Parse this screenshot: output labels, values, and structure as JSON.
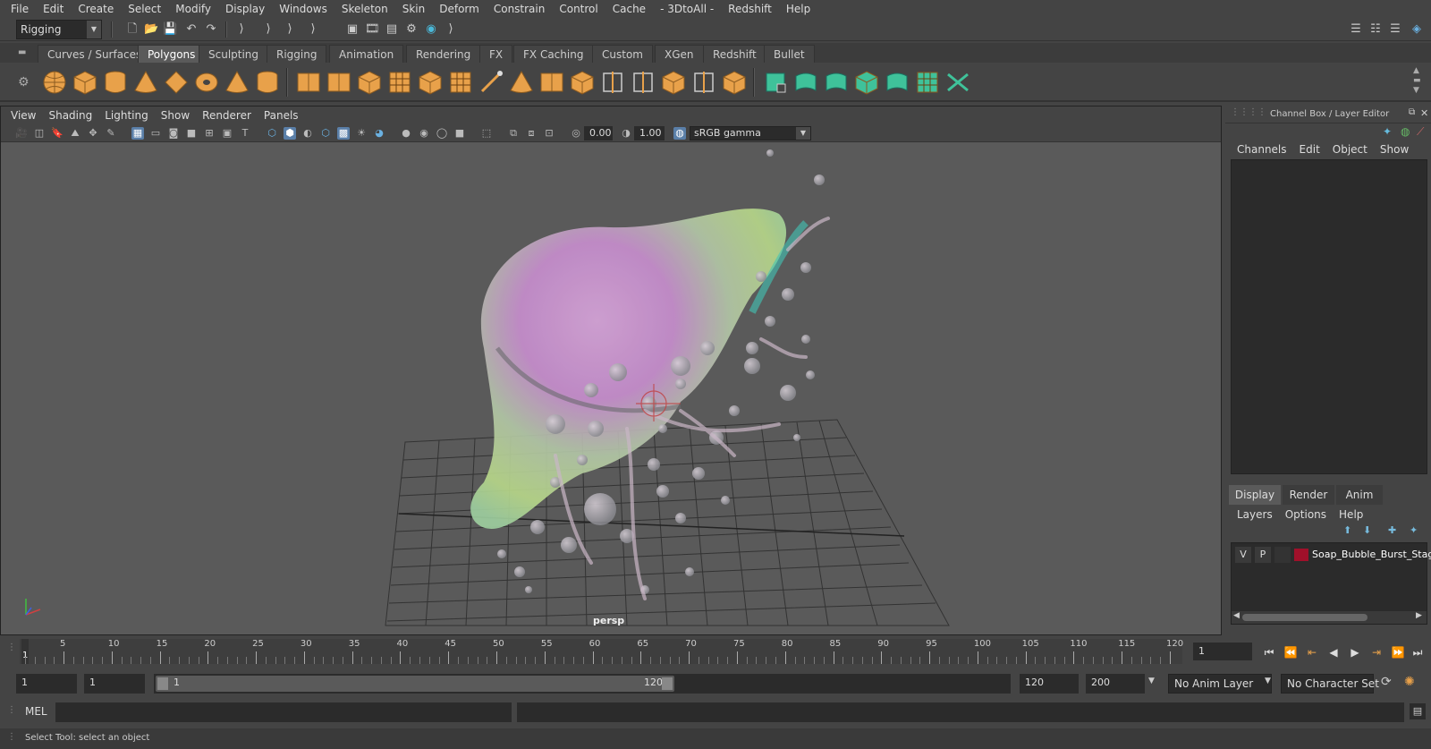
{
  "menu": [
    "File",
    "Edit",
    "Create",
    "Select",
    "Modify",
    "Display",
    "Windows",
    "Skeleton",
    "Skin",
    "Deform",
    "Constrain",
    "Control",
    "Cache",
    "- 3DtoAll -",
    "Redshift",
    "Help"
  ],
  "status": {
    "menuset": "Rigging"
  },
  "shelf_tabs": [
    {
      "label": "Curves / Surfaces",
      "active": false
    },
    {
      "label": "Polygons",
      "active": true
    },
    {
      "label": "Sculpting",
      "active": false
    },
    {
      "label": "Rigging",
      "active": false
    },
    {
      "label": "Animation",
      "active": false
    },
    {
      "label": "Rendering",
      "active": false
    },
    {
      "label": "FX",
      "active": false
    },
    {
      "label": "FX Caching",
      "active": false
    },
    {
      "label": "Custom",
      "active": false
    },
    {
      "label": "XGen",
      "active": false
    },
    {
      "label": "Redshift",
      "active": false
    },
    {
      "label": "Bullet",
      "active": false
    }
  ],
  "colors": {
    "poly_icon": "#e8a14a",
    "green_icon": "#3fc29a",
    "accent": "#5a7fa8",
    "layer_color": "#a0102a"
  },
  "viewport": {
    "menu": [
      "View",
      "Shading",
      "Lighting",
      "Show",
      "Renderer",
      "Panels"
    ],
    "exposure": "0.00",
    "gamma": "1.00",
    "colorspace": "sRGB gamma",
    "camera_label": "persp"
  },
  "channel_box": {
    "title": "Channel Box / Layer Editor",
    "menu": [
      "Channels",
      "Edit",
      "Object",
      "Show"
    ]
  },
  "layer_editor": {
    "tabs": [
      {
        "label": "Display",
        "active": true
      },
      {
        "label": "Render",
        "active": false
      },
      {
        "label": "Anim",
        "active": false
      }
    ],
    "menu": [
      "Layers",
      "Options",
      "Help"
    ],
    "layers": [
      {
        "v": "V",
        "p": "P",
        "name": "Soap_Bubble_Burst_Stag"
      }
    ]
  },
  "timeline": {
    "ticks": [
      "5",
      "10",
      "15",
      "20",
      "25",
      "30",
      "35",
      "40",
      "45",
      "50",
      "55",
      "60",
      "65",
      "70",
      "75",
      "80",
      "85",
      "90",
      "95",
      "100",
      "105",
      "110",
      "115",
      "120"
    ],
    "current_frame_marker": "1",
    "current_frame": "1"
  },
  "range": {
    "start": "1",
    "playback_start": "1",
    "slider_start": "1",
    "slider_end": "120",
    "playback_end": "120",
    "end": "200",
    "anim_layer": "No Anim Layer",
    "character_set": "No Character Set"
  },
  "cmdline": {
    "label": "MEL"
  },
  "helpline": {
    "text": "Select Tool: select an object"
  }
}
